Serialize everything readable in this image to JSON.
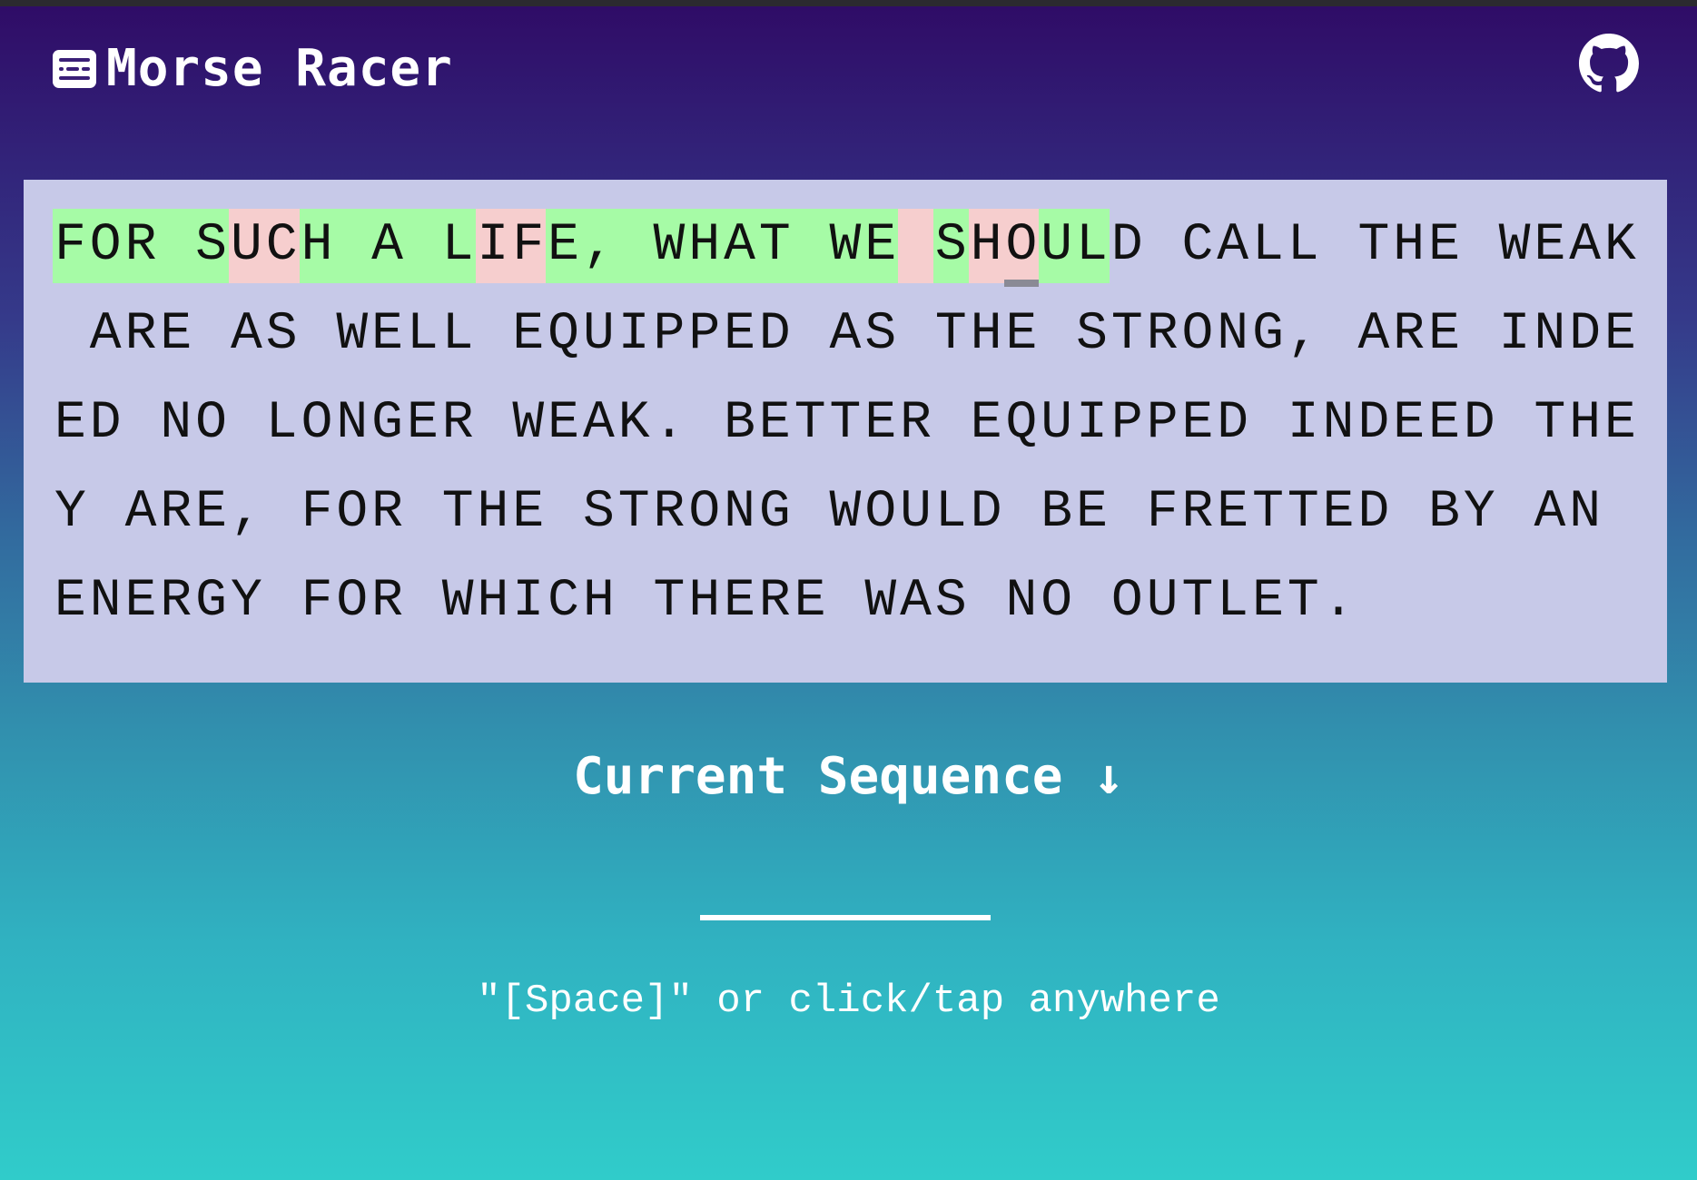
{
  "app": {
    "title": "Morse Racer",
    "logo_icon": "morse-keyboard-icon",
    "github_icon": "github-icon"
  },
  "typing_text": {
    "lines": [
      "FOR SUCH A LIFE, WHAT WE SHOULD CALL THE WEAK",
      " ARE AS WELL EQUIPPED AS THE STRONG, ARE INDE",
      "ED NO LONGER WEAK. BETTER EQUIPPED INDEED THE",
      "Y ARE, FOR THE STRONG WOULD BE FRETTED BY AN ",
      "ENERGY FOR WHICH THERE WAS NO OUTLET."
    ],
    "line1_status": "CCCCCWWCCCCCWWCCCCCCCCCCWCWWCC",
    "cursor_index": 27
  },
  "sequence": {
    "label": "Current Sequence ↓",
    "current": ""
  },
  "hint": "\"[Space]\" or click/tap anywhere",
  "colors": {
    "correct": "#a6fba6",
    "wrong": "#f6cece",
    "panel": "#c7c9e8",
    "cursor": "#8a8a95"
  }
}
